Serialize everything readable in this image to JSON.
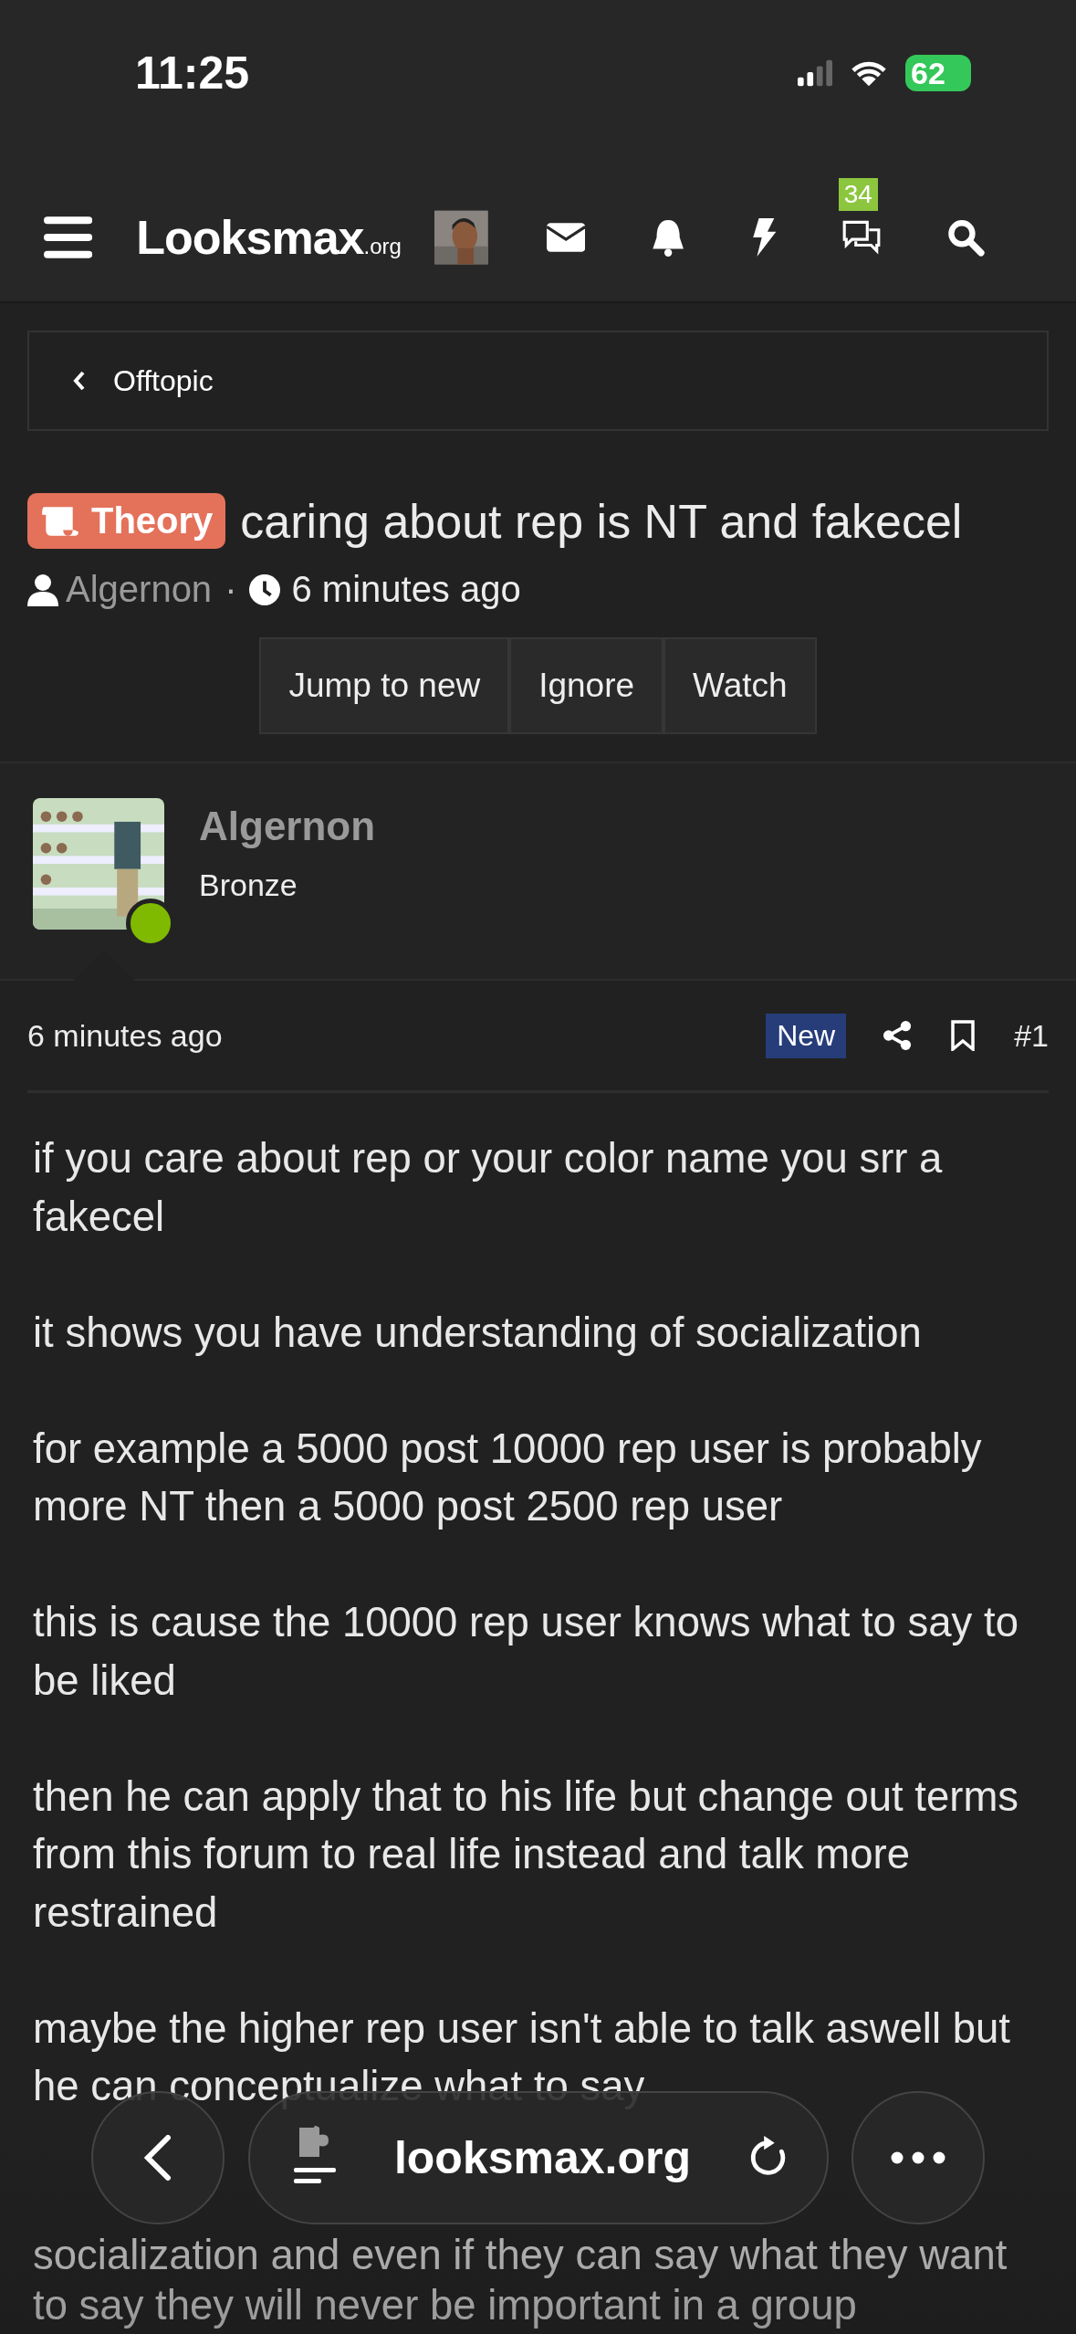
{
  "status_bar": {
    "time": "11:25",
    "battery": "62"
  },
  "nav": {
    "logo_main": "Looksmax",
    "logo_suffix": ".org",
    "conversations_badge": "34"
  },
  "breadcrumb": {
    "label": "Offtopic"
  },
  "thread": {
    "prefix": "Theory",
    "title": "caring about rep is NT and fakecel",
    "author": "Algernon",
    "separator": "·",
    "time": "6 minutes ago"
  },
  "actions": [
    {
      "label": "Jump to new"
    },
    {
      "label": "Ignore"
    },
    {
      "label": "Watch"
    }
  ],
  "post": {
    "author": "Algernon",
    "rank": "Bronze",
    "online": true,
    "time": "6 minutes ago",
    "new_badge": "New",
    "number": "#1",
    "paragraphs": [
      "if you care about rep or your color name you srr a fakecel",
      "it shows you have understanding of socialization",
      "for example a 5000 post 10000 rep user is probably more NT then a 5000 post 2500 rep user",
      "this is cause the 10000 rep user knows what to say to be liked",
      "then he can apply that to his life but change out terms from this forum to real life instead and talk more restrained",
      "maybe the higher rep user isn't able to talk aswell but he can conceptualize what to say",
      "socialization and even if they can say what they want to say they will never be important in a group"
    ]
  },
  "browser_bar": {
    "url": "looksmax.org"
  }
}
